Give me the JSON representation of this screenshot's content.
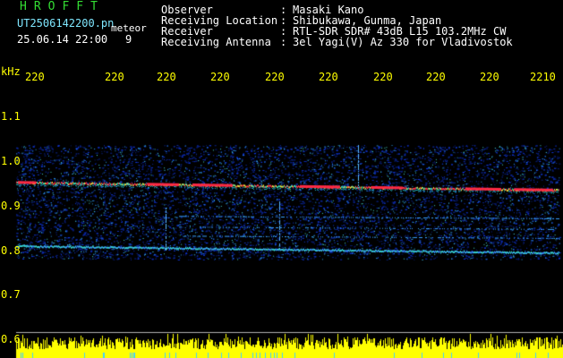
{
  "header": {
    "app_title": "HROFFT",
    "file_name": "UT2506142200.pn",
    "mode": "meteor",
    "datetime": "25.06.14 22:00",
    "frame": "9"
  },
  "info": {
    "rows": [
      {
        "label": "Observer",
        "sep": ":",
        "value": "Masaki Kano"
      },
      {
        "label": "Receiving Location",
        "sep": ":",
        "value": "Shibukawa, Gunma, Japan"
      },
      {
        "label": "Receiver",
        "sep": ":",
        "value": "RTL-SDR SDR# 43dB L15 103.2MHz CW"
      },
      {
        "label": "Receiving Antenna",
        "sep": ":",
        "value": "3el Yagi(V) Az 330 for Vladivostok"
      }
    ]
  },
  "axes": {
    "y_unit": "kHz",
    "x_ticks": [
      "220",
      "220",
      "220",
      "220",
      "220",
      "220",
      "220",
      "220",
      "220",
      "2210"
    ],
    "y_ticks": [
      "1.1",
      "1.0",
      "0.9",
      "0.8",
      "0.7",
      "0.6"
    ]
  },
  "colors": {
    "background": "#000000",
    "title": "#33dd33",
    "file_name": "#7fe7ff",
    "text": "#ffffff",
    "axis_labels": "#ffff00",
    "meteor_echo": "#ff3344",
    "noise_floor": "#0a1aa8"
  }
}
